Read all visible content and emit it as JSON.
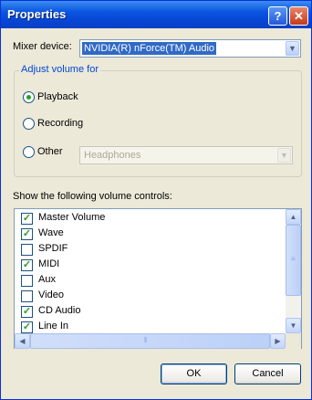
{
  "window": {
    "title": "Properties"
  },
  "titlebar": {
    "help_glyph": "?",
    "close_glyph": "✕"
  },
  "mixer": {
    "label": "Mixer device:",
    "selected": "NVIDIA(R) nForce(TM) Audio"
  },
  "adjust": {
    "title": "Adjust volume for",
    "options": [
      {
        "label": "Playback",
        "checked": true
      },
      {
        "label": "Recording",
        "checked": false
      },
      {
        "label": "Other",
        "checked": false
      }
    ],
    "other_device": "Headphones"
  },
  "controls": {
    "label": "Show the following volume controls:",
    "items": [
      {
        "label": "Master Volume",
        "checked": true
      },
      {
        "label": "Wave",
        "checked": true
      },
      {
        "label": "SPDIF",
        "checked": false
      },
      {
        "label": "MIDI",
        "checked": true
      },
      {
        "label": "Aux",
        "checked": false
      },
      {
        "label": "Video",
        "checked": false
      },
      {
        "label": "CD Audio",
        "checked": true
      },
      {
        "label": "Line In",
        "checked": true
      }
    ]
  },
  "buttons": {
    "ok": "OK",
    "cancel": "Cancel"
  },
  "icons": {
    "arrow": "chevron-down-icon",
    "check": "check-icon"
  },
  "colors": {
    "titlebar": "#0a55e0",
    "accent": "#316ac5",
    "check": "#21a121",
    "group_title": "#0046d5"
  }
}
